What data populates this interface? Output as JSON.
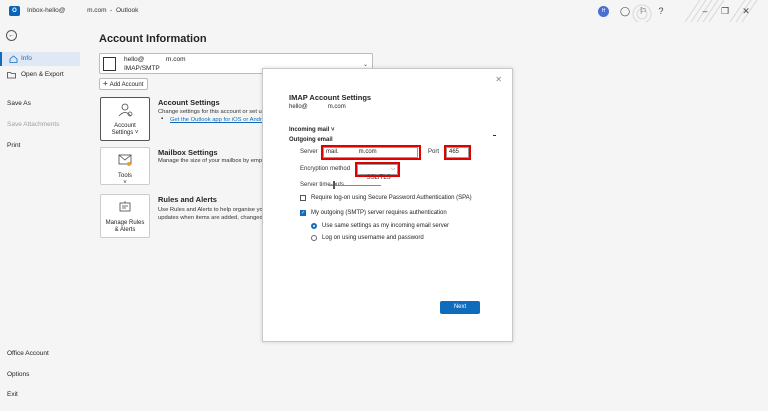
{
  "window": {
    "title": "Inbox-hello@            m.com  -  Outlook",
    "app_logo": "O",
    "avatar_initials": "H"
  },
  "sidebar": {
    "back_icon": "back-arrow-icon",
    "items": [
      {
        "label": "Info"
      },
      {
        "label": "Open & Export"
      },
      {
        "label": "Save As"
      },
      {
        "label": "Save Attachments"
      },
      {
        "label": "Print"
      },
      {
        "label": "Office Account"
      },
      {
        "label": "Options"
      },
      {
        "label": "Exit"
      }
    ]
  },
  "main": {
    "title": "Account Information",
    "account": {
      "email": "hello@            m.com",
      "type": "IMAP/SMTP"
    },
    "add_account_label": "Add Account",
    "account_settings": {
      "tile_label": "Account Settings ˅",
      "heading": "Account Settings",
      "desc": "Change settings for this account or set up",
      "link": "Get the Outlook app for iOS or Android"
    },
    "mailbox_settings": {
      "tile_label": "Tools",
      "tile_chev": "˅",
      "heading": "Mailbox Settings",
      "desc": "Manage the size of your mailbox by emptying"
    },
    "rules_alerts": {
      "tile_label": "Manage Rules & Alerts",
      "heading": "Rules and Alerts",
      "desc1": "Use Rules and Alerts to help organise your",
      "desc2": "updates when items are added, changed"
    }
  },
  "dialog": {
    "title": "IMAP Account Settings",
    "subtitle": "hello@            m.com",
    "incoming_label": "Incoming mail ˅",
    "outgoing_label": "Outgoing email",
    "server_label": "Server",
    "server_value": "mail.            m.com",
    "port_label": "Port",
    "port_value": "465",
    "encryption_label": "Encryption method",
    "encryption_value": "SSL/TLS",
    "timeout_label": "Server time-outs",
    "spa_label": "Require log-on using Secure Password Authentication (SPA)",
    "smtp_auth_label": "My outgoing (SMTP) server requires authentication",
    "same_settings_label": "Use same settings as my incoming email server",
    "logon_label": "Log on using username and password",
    "next_label": "Next",
    "close_icon": "close-icon"
  },
  "colors": {
    "accent": "#0f6cbd",
    "highlight": "#e00000"
  }
}
